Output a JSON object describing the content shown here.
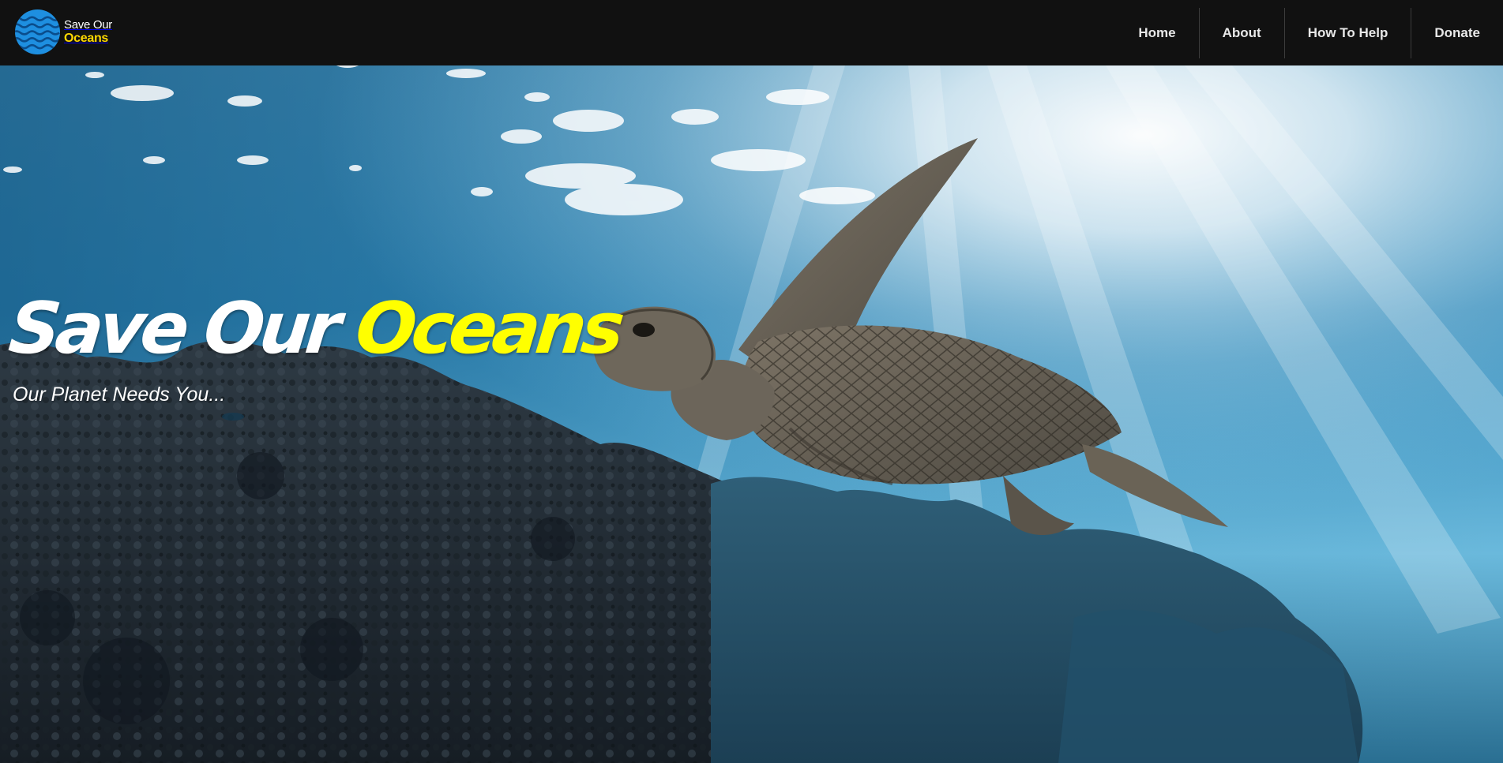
{
  "brand": {
    "line1": "Save Our",
    "line2": "Oceans",
    "logo_icon": "wave-globe-icon",
    "logo_color": "#1e8fe0",
    "accent_yellow": "#ffd800"
  },
  "nav": {
    "items": [
      {
        "label": "Home"
      },
      {
        "label": "About"
      },
      {
        "label": "How To Help"
      },
      {
        "label": "Donate"
      }
    ],
    "background": "#111111"
  },
  "hero": {
    "title_part1": "Save Our",
    "title_part2": "Oceans",
    "subtitle": "Our Planet Needs You...",
    "title_highlight_color": "#ffff00",
    "image_subject": "sea-turtle-over-coral-reef"
  }
}
